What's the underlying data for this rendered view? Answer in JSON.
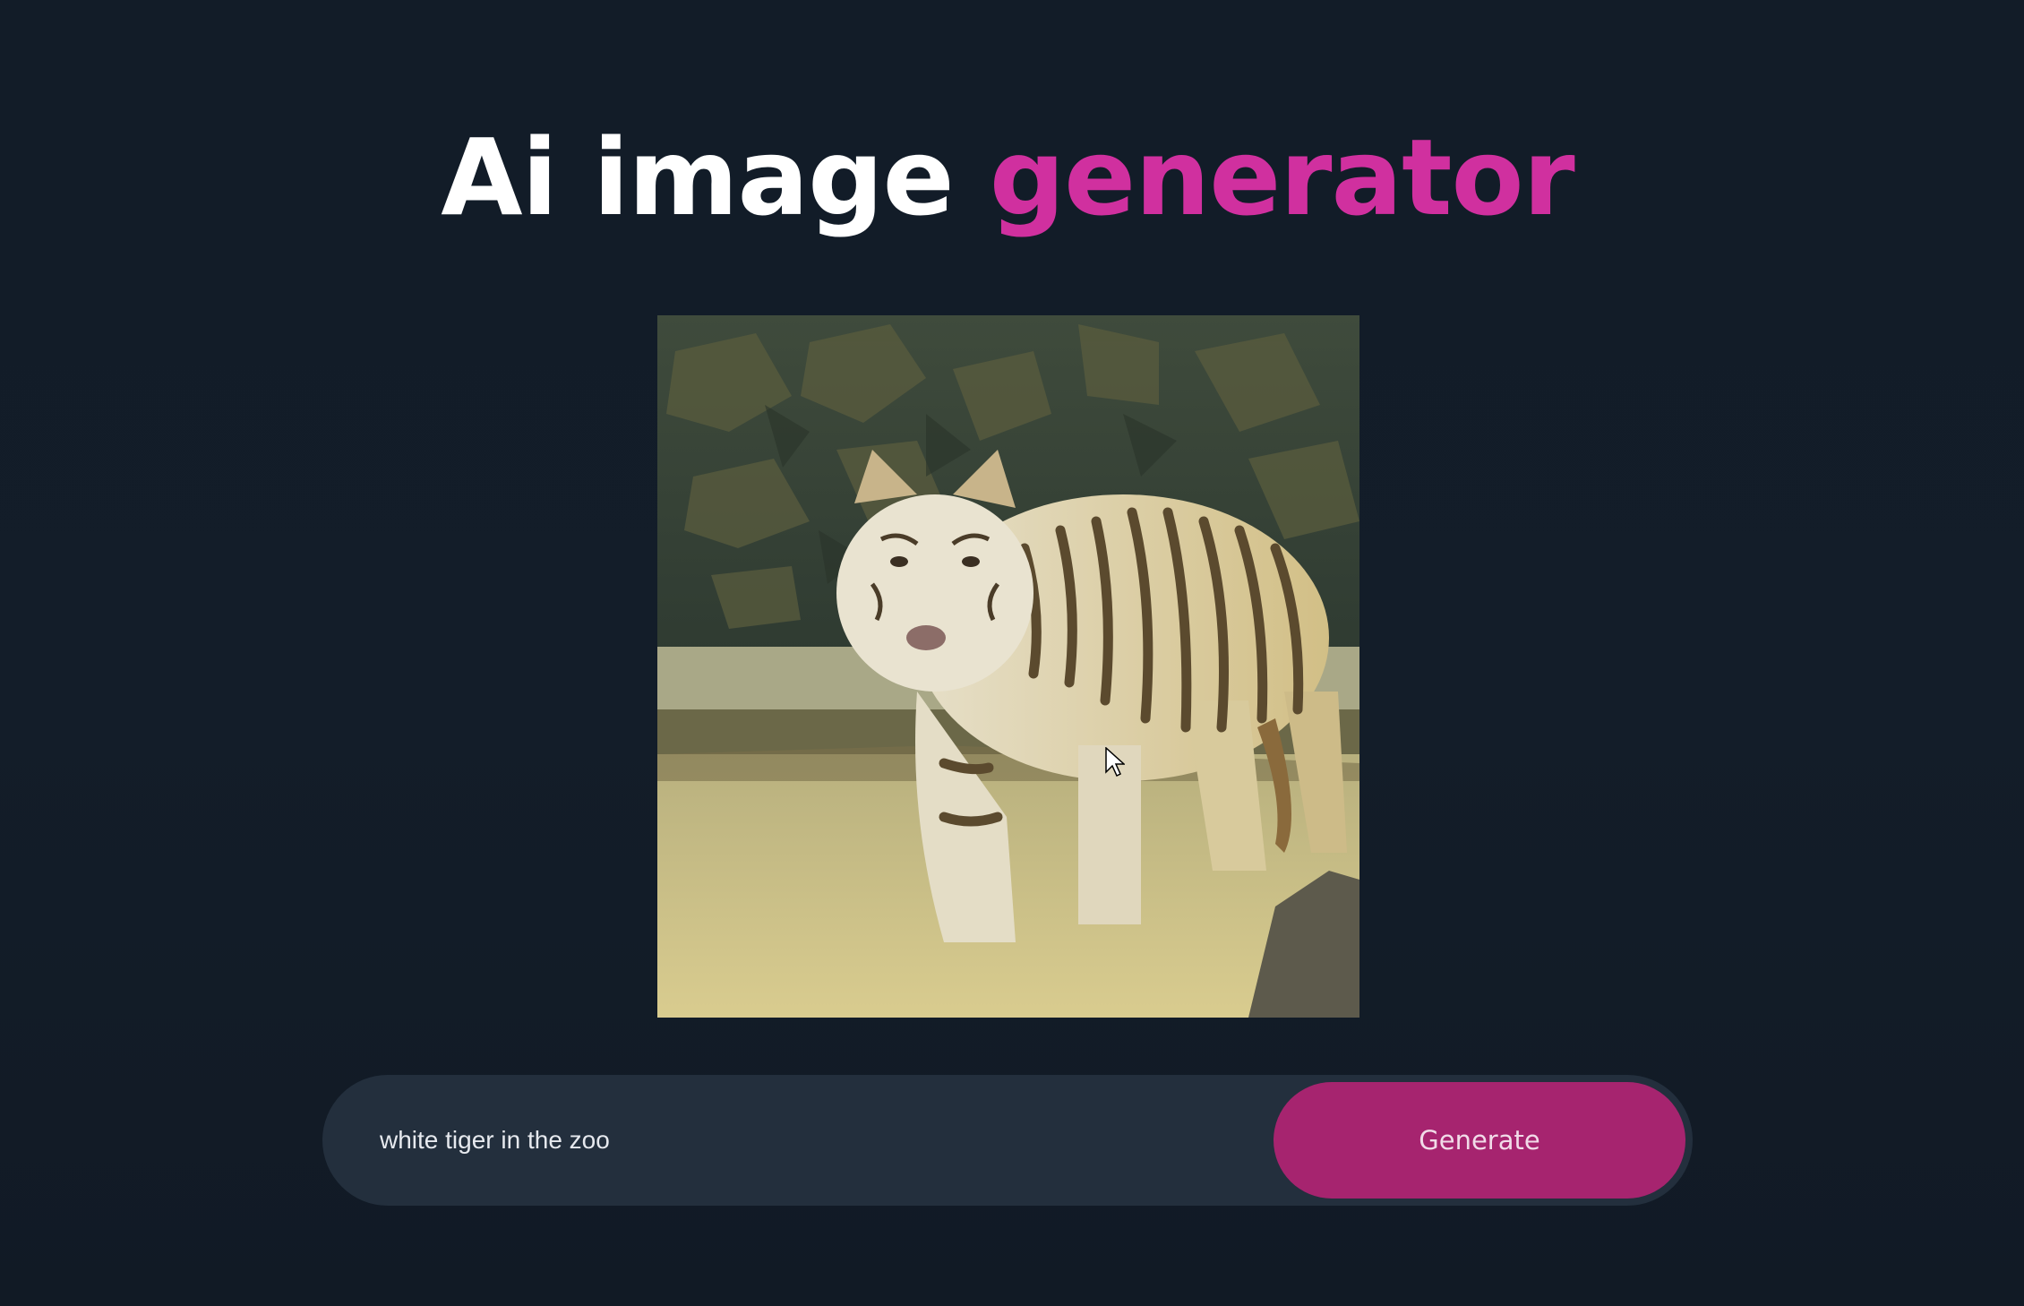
{
  "header": {
    "title_main": "Ai image",
    "title_accent": "generator"
  },
  "generated_image": {
    "icon": "generated-image-white-tiger"
  },
  "prompt": {
    "value": "white tiger in the zoo",
    "placeholder": ""
  },
  "generate_button": {
    "label": "Generate"
  },
  "colors": {
    "background": "#131d29",
    "accent": "#d0309f",
    "button": "#a6246f",
    "input_bg": "#232f3d"
  }
}
